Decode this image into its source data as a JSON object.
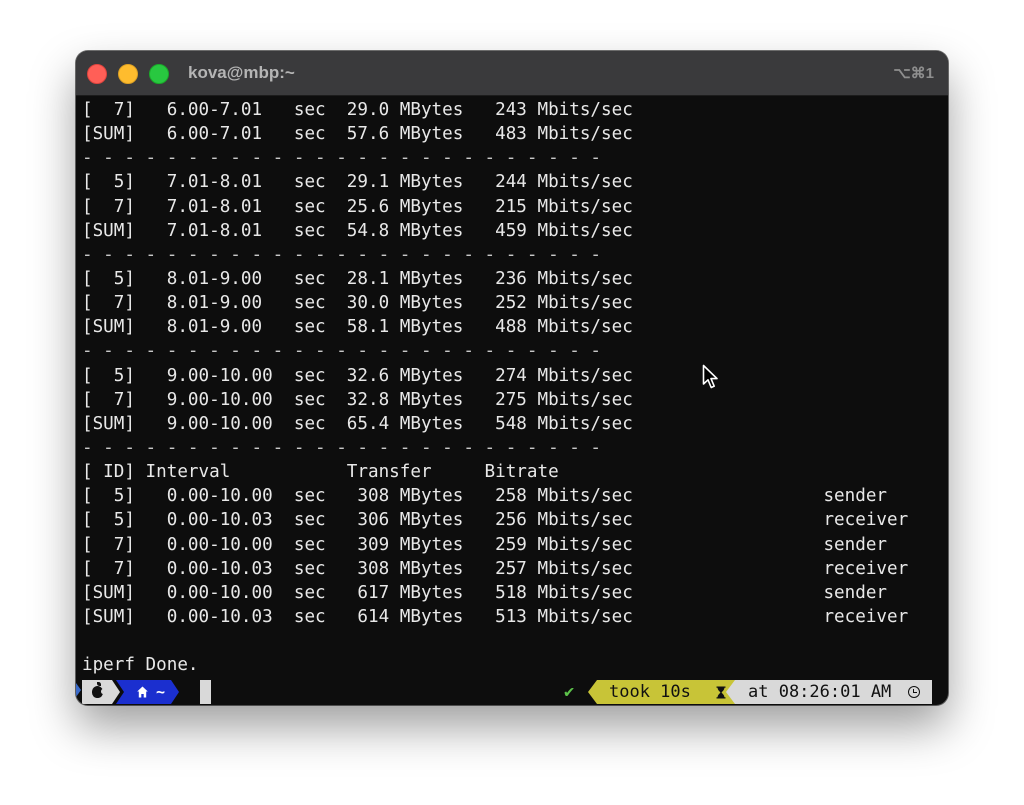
{
  "window": {
    "title": "kova@mbp:~",
    "shortcut": "⌥⌘1"
  },
  "terminal": {
    "lines": [
      "[  7]   6.00-7.01   sec  29.0 MBytes   243 Mbits/sec",
      "[SUM]   6.00-7.01   sec  57.6 MBytes   483 Mbits/sec",
      "- - - - - - - - - - - - - - - - - - - - - - - - -",
      "[  5]   7.01-8.01   sec  29.1 MBytes   244 Mbits/sec",
      "[  7]   7.01-8.01   sec  25.6 MBytes   215 Mbits/sec",
      "[SUM]   7.01-8.01   sec  54.8 MBytes   459 Mbits/sec",
      "- - - - - - - - - - - - - - - - - - - - - - - - -",
      "[  5]   8.01-9.00   sec  28.1 MBytes   236 Mbits/sec",
      "[  7]   8.01-9.00   sec  30.0 MBytes   252 Mbits/sec",
      "[SUM]   8.01-9.00   sec  58.1 MBytes   488 Mbits/sec",
      "- - - - - - - - - - - - - - - - - - - - - - - - -",
      "[  5]   9.00-10.00  sec  32.6 MBytes   274 Mbits/sec",
      "[  7]   9.00-10.00  sec  32.8 MBytes   275 Mbits/sec",
      "[SUM]   9.00-10.00  sec  65.4 MBytes   548 Mbits/sec",
      "- - - - - - - - - - - - - - - - - - - - - - - - -",
      "[ ID] Interval           Transfer     Bitrate",
      "[  5]   0.00-10.00  sec   308 MBytes   258 Mbits/sec                  sender",
      "[  5]   0.00-10.03  sec   306 MBytes   256 Mbits/sec                  receiver",
      "[  7]   0.00-10.00  sec   309 MBytes   259 Mbits/sec                  sender",
      "[  7]   0.00-10.03  sec   308 MBytes   257 Mbits/sec                  receiver",
      "[SUM]   0.00-10.00  sec   617 MBytes   518 Mbits/sec                  sender",
      "[SUM]   0.00-10.03  sec   614 MBytes   513 Mbits/sec                  receiver",
      "",
      "iperf Done."
    ]
  },
  "prompt": {
    "os_icon": "apple-icon",
    "dir_icon": "home-icon",
    "dir": "~",
    "status_icon": "check-icon",
    "status": "✔",
    "took": "took 10s",
    "took_icon": "hourglass-icon",
    "time": "at 08:26:01 AM",
    "time_icon": "clock-icon",
    "colors": {
      "dir_bg": "#1b2fcf",
      "took_bg": "#c8c437",
      "segment_bg": "#d9d9d9",
      "ok": "#5cc24a"
    }
  },
  "colors": {
    "terminal_bg": "#0d0d0d",
    "terminal_fg": "#e8e8e8",
    "titlebar_bg": "#3a3a3c"
  }
}
